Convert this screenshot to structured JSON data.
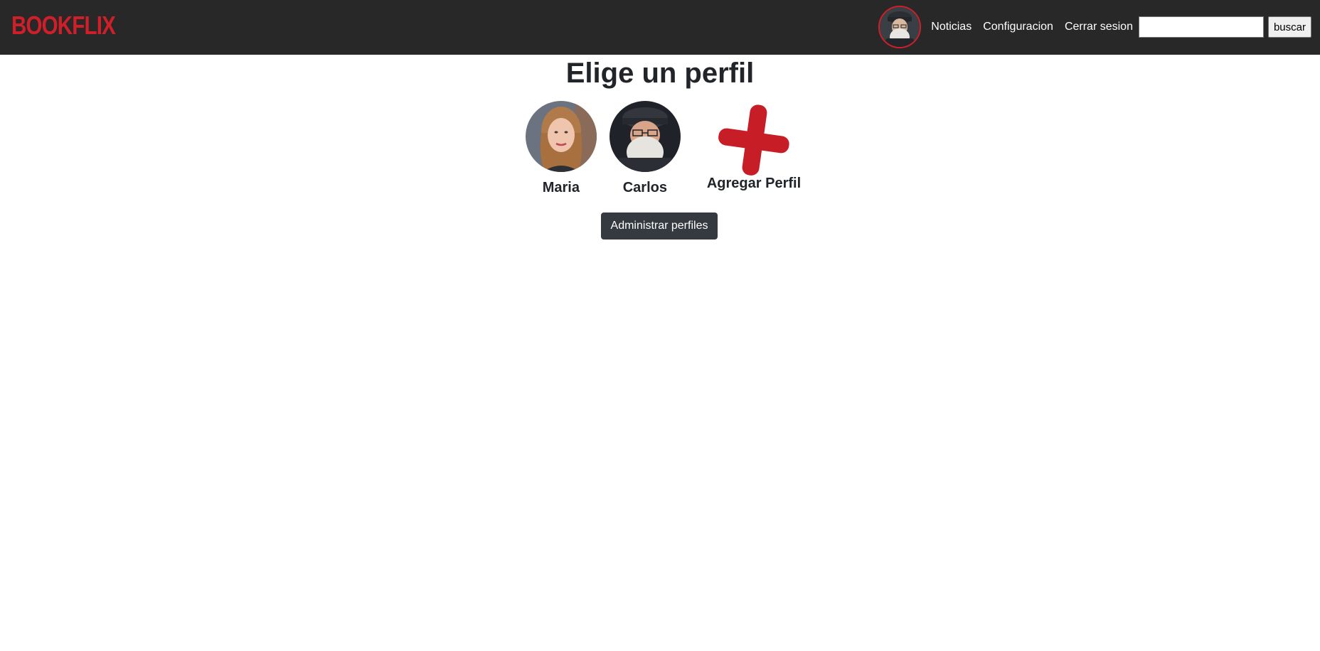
{
  "header": {
    "brand": "BOOKFLIX",
    "nav_links": [
      "Noticias",
      "Configuracion",
      "Cerrar sesion"
    ],
    "search_value": "",
    "search_button": "buscar",
    "avatar_icon": "user-avatar-icon"
  },
  "main": {
    "title": "Elige un perfil",
    "profiles": [
      {
        "name": "Maria",
        "icon": "profile-avatar-maria"
      },
      {
        "name": "Carlos",
        "icon": "profile-avatar-carlos"
      }
    ],
    "add_profile": {
      "label": "Agregar Perfil",
      "icon": "plus-icon"
    },
    "manage_button": "Administrar perfiles"
  },
  "colors": {
    "brand_red": "#d11f2a",
    "navbar_bg": "#282828",
    "button_dark": "#343a40"
  }
}
